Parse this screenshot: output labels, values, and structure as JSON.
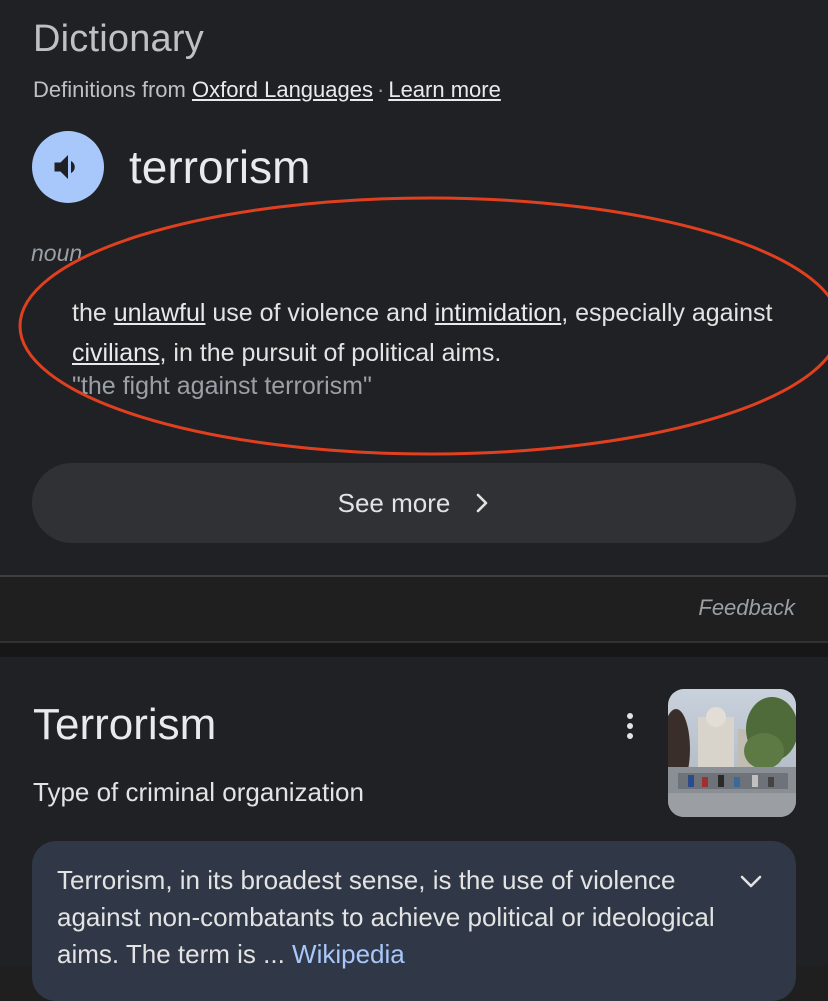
{
  "dictionary": {
    "title": "Dictionary",
    "source_prefix": "Definitions from",
    "source_link": "Oxford Languages",
    "separator": "·",
    "learn_more": "Learn more",
    "word": "terrorism",
    "part_of_speech": "noun",
    "definition": {
      "t1": "the ",
      "l1": "unlawful",
      "t2": " use of violence and ",
      "l2": "intimidation",
      "t3": ", especially against ",
      "l3": "civilians",
      "t4": ", in the pursuit of political aims."
    },
    "example": "\"the fight against terrorism\"",
    "see_more": "See more",
    "feedback": "Feedback"
  },
  "knowledge_panel": {
    "title": "Terrorism",
    "subtitle": "Type of criminal organization",
    "description": "Terrorism, in its broadest sense, is the use of violence against non-combatants to achieve political or ideological aims. The term is ",
    "ellipsis": "...",
    "source": "Wikipedia"
  },
  "colors": {
    "accent_blue": "#a8c7fa",
    "annotation_red": "#e0401f",
    "background": "#202124"
  },
  "icons": {
    "speaker": "volume-icon",
    "chevron_right": "chevron-right-icon",
    "more": "more-vert-icon",
    "expand": "chevron-down-icon"
  }
}
